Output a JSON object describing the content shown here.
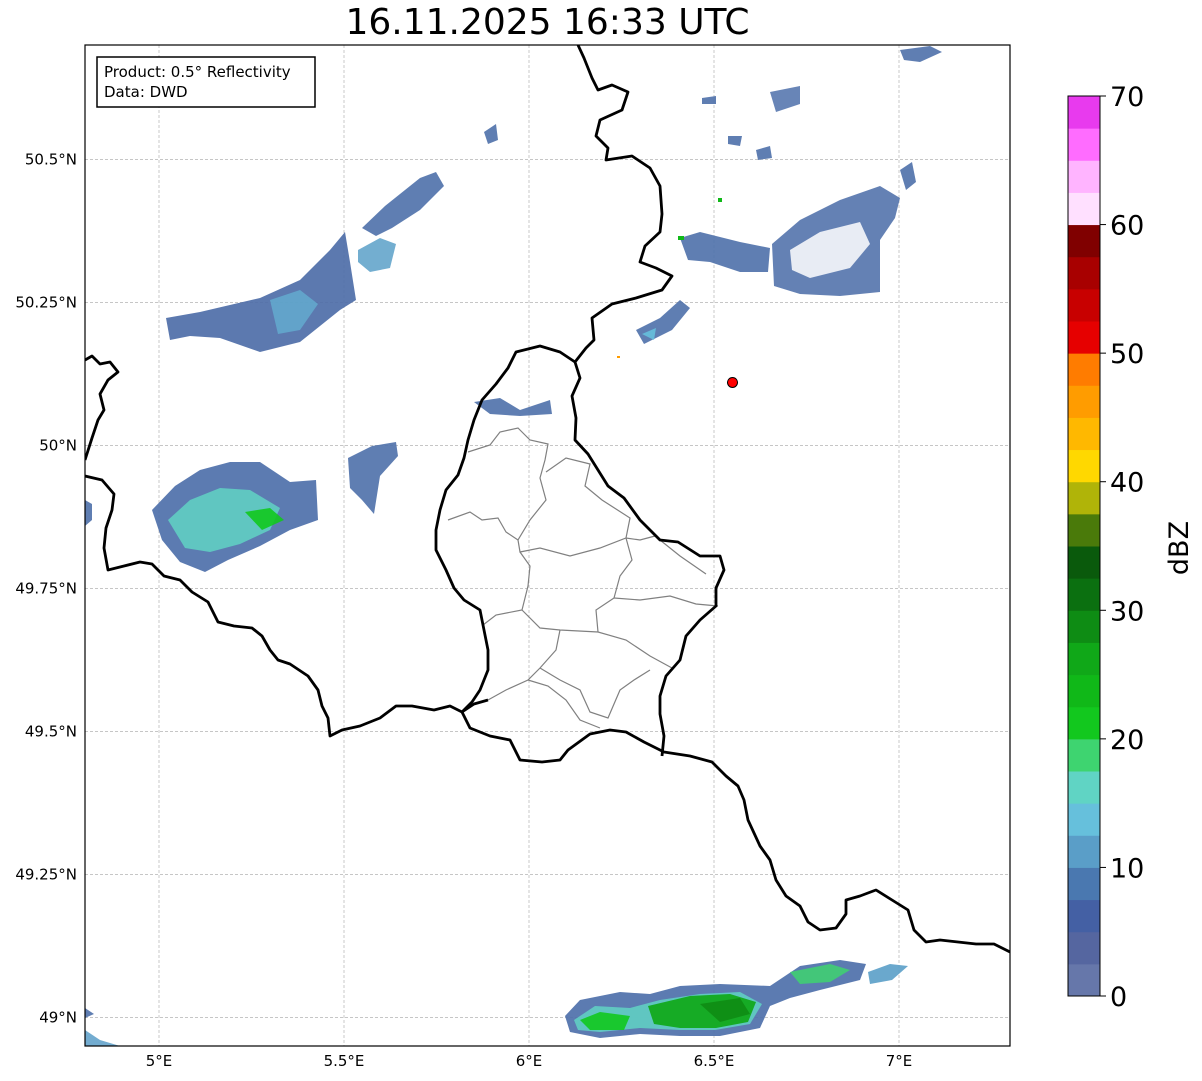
{
  "title": "16.11.2025 16:33 UTC",
  "info_box": {
    "product": "Product: 0.5° Reflectivity",
    "data": "Data: DWD"
  },
  "map": {
    "lon_range": [
      4.8,
      7.3
    ],
    "lat_range": [
      48.95,
      50.7
    ],
    "lon_ticks": [
      {
        "value": 5.0,
        "label": "5°E"
      },
      {
        "value": 5.5,
        "label": "5.5°E"
      },
      {
        "value": 6.0,
        "label": "6°E"
      },
      {
        "value": 6.5,
        "label": "6.5°E"
      },
      {
        "value": 7.0,
        "label": "7°E"
      }
    ],
    "lat_ticks": [
      {
        "value": 49.0,
        "label": "49°N"
      },
      {
        "value": 49.25,
        "label": "49.25°N"
      },
      {
        "value": 49.5,
        "label": "49.5°N"
      },
      {
        "value": 49.75,
        "label": "49.75°N"
      },
      {
        "value": 50.0,
        "label": "50°N"
      },
      {
        "value": 50.25,
        "label": "50.25°N"
      },
      {
        "value": 50.5,
        "label": "50.5°N"
      }
    ],
    "radar_site": {
      "lon": 6.55,
      "lat": 50.11,
      "color": "#ff0000"
    },
    "gridlines": true
  },
  "colorbar": {
    "label": "dBZ",
    "min": 0,
    "max": 70,
    "ticks": [
      0,
      10,
      20,
      30,
      40,
      50,
      60,
      70
    ],
    "colors": [
      "#6677aa",
      "#5566a0",
      "#4460a4",
      "#4a78b0",
      "#5a9ec8",
      "#66c0dc",
      "#60d4c4",
      "#3ed470",
      "#12c81e",
      "#10b818",
      "#10a818",
      "#0e8c14",
      "#0b7010",
      "#0a5a0c",
      "#4a7a0a",
      "#b0b408",
      "#ffd800",
      "#ffb800",
      "#ff9c00",
      "#ff7c00",
      "#e60000",
      "#c80000",
      "#a80000",
      "#800000",
      "#ffe0ff",
      "#ffb4ff",
      "#ff6cff",
      "#e83aee"
    ]
  }
}
